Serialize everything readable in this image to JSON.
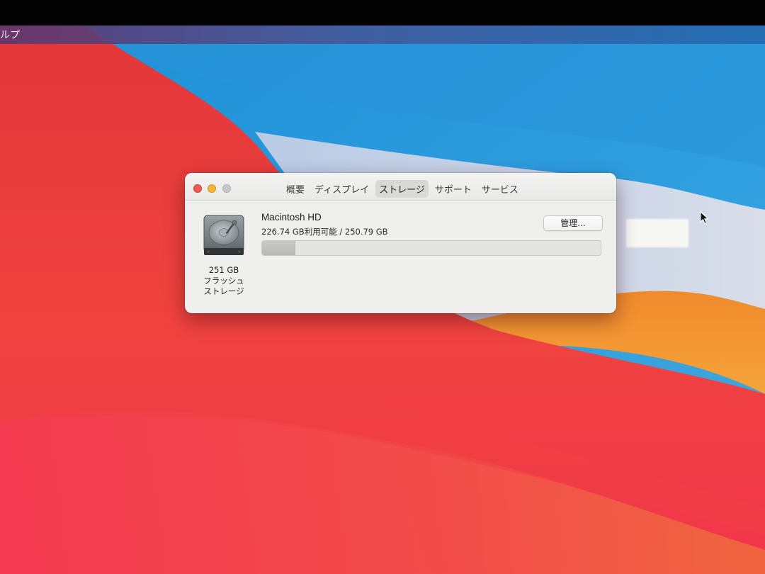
{
  "menubar": {
    "partial_item": "ルプ"
  },
  "window": {
    "tabs": [
      {
        "label": "概要",
        "active": false
      },
      {
        "label": "ディスプレイ",
        "active": false
      },
      {
        "label": "ストレージ",
        "active": true
      },
      {
        "label": "サポート",
        "active": false
      },
      {
        "label": "サービス",
        "active": false
      }
    ],
    "disk": {
      "icon": "hard-drive-icon",
      "size_label": "251 GB",
      "type_line1": "フラッシュ",
      "type_line2": "ストレージ"
    },
    "volume": {
      "name": "Macintosh HD",
      "usage_text": "226.74 GB利用可能 / 250.79 GB",
      "available_gb": 226.74,
      "total_gb": 250.79,
      "used_fraction": 0.096
    },
    "manage_button_label": "管理..."
  },
  "colors": {
    "traffic_close": "#ee5b52",
    "traffic_minimize": "#f2b53a",
    "traffic_zoom_disabled": "#c8c8c7",
    "window_bg": "#efefee"
  }
}
